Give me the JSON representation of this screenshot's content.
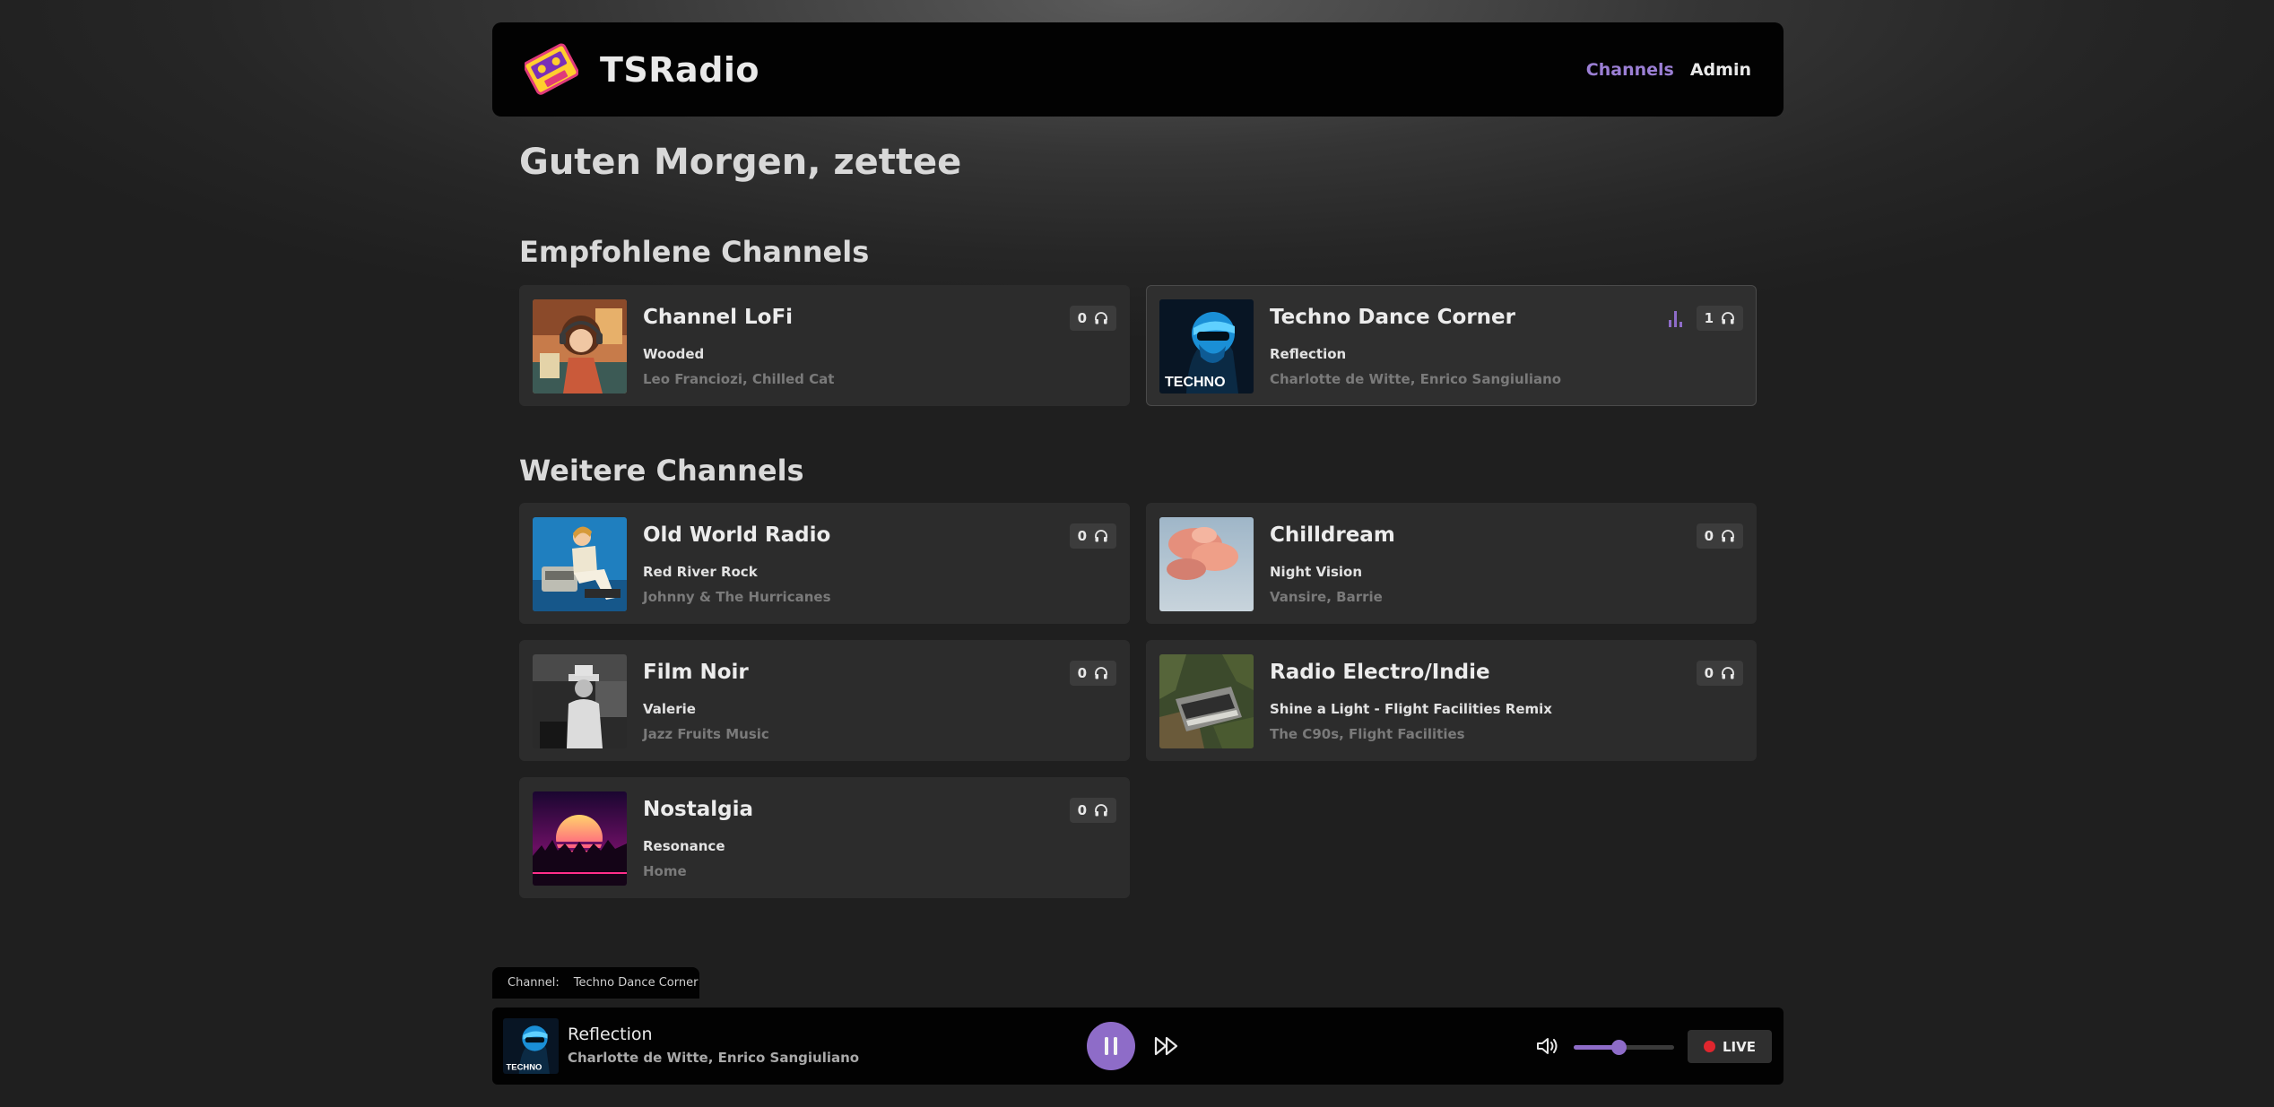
{
  "app": {
    "brand": "TSRadio"
  },
  "nav": {
    "items": [
      {
        "label": "Channels",
        "active": true
      },
      {
        "label": "Admin",
        "active": false
      }
    ]
  },
  "greeting": "Guten Morgen, zettee",
  "sections": {
    "featured": {
      "title": "Empfohlene Channels",
      "channels": [
        {
          "name": "Channel LoFi",
          "track": "Wooded",
          "artist": "Leo Franciozi, Chilled Cat",
          "listeners": "0",
          "playing": false,
          "image": "lofi-girl"
        },
        {
          "name": "Techno Dance Corner",
          "track": "Reflection",
          "artist": "Charlotte de Witte, Enrico Sangiuliano",
          "listeners": "1",
          "playing": true,
          "image": "techno-cover",
          "image_text": "TECHNO"
        }
      ]
    },
    "more": {
      "title": "Weitere Channels",
      "channels": [
        {
          "name": "Old World Radio",
          "track": "Red River Rock",
          "artist": "Johnny & The Hurricanes",
          "listeners": "0",
          "image": "pinup-radio"
        },
        {
          "name": "Chilldream",
          "track": "Night Vision",
          "artist": "Vansire, Barrie",
          "listeners": "0",
          "image": "pink-clouds"
        },
        {
          "name": "Film Noir",
          "track": "Valerie",
          "artist": "Jazz Fruits Music",
          "listeners": "0",
          "image": "noir-man"
        },
        {
          "name": "Radio Electro/Indie",
          "track": "Shine a Light - Flight Facilities Remix",
          "artist": "The C90s, Flight Facilities",
          "listeners": "0",
          "image": "synth-in-forest"
        },
        {
          "name": "Nostalgia",
          "track": "Resonance",
          "artist": "Home",
          "listeners": "0",
          "image": "synthwave-sun"
        }
      ]
    }
  },
  "player": {
    "channel_label": "Channel:",
    "channel_name": "Techno Dance Corner",
    "title": "Reflection",
    "artist": "Charlotte de Witte, Enrico Sangiuliano",
    "volume": 0.45,
    "live_label": "LIVE"
  },
  "colors": {
    "accent": "#8e6cc8",
    "nav_active": "#9b7fd4",
    "live": "#e0262e",
    "card": "#2c2c2c",
    "header": "#020202"
  },
  "icons": {
    "listeners": "headphones-icon",
    "playing": "equalizer-icon",
    "pause": "pause-icon",
    "skip": "fast-forward-icon",
    "volume": "volume-icon",
    "logo": "cassette-logo-icon"
  }
}
